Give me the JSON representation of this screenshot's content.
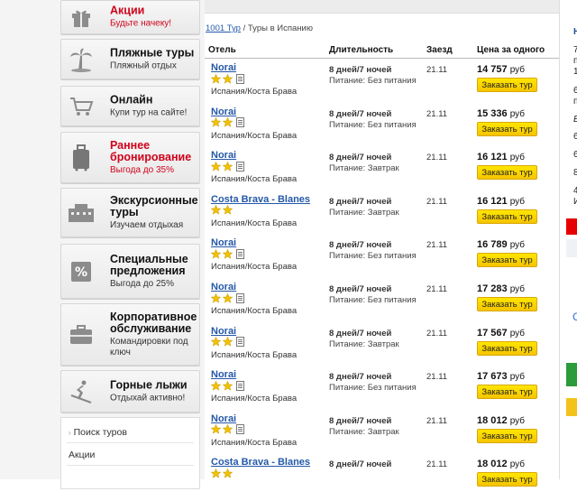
{
  "sidebar": {
    "items": [
      {
        "title": "Акции",
        "sub": "Будьте начеку!",
        "icon": "gift-icon",
        "red": true
      },
      {
        "title": "Пляжные туры",
        "sub": "Пляжный отдых",
        "icon": "palm-icon",
        "red": false
      },
      {
        "title": "Онлайн",
        "sub": "Купи тур на сайте!",
        "icon": "cart-icon",
        "red": false
      },
      {
        "title": "Раннее бронирование",
        "sub": "Выгода до 35%",
        "icon": "suitcase-icon",
        "red": true
      },
      {
        "title": "Экскурсионные туры",
        "sub": "Изучаем отдыхая",
        "icon": "building-icon",
        "red": false
      },
      {
        "title": "Специальные предложения",
        "sub": "Выгода до 25%",
        "icon": "percent-icon",
        "red": false
      },
      {
        "title": "Корпоративное обслуживание",
        "sub": "Командировки под ключ",
        "icon": "briefcase-icon",
        "red": false
      },
      {
        "title": "Горные лыжи",
        "sub": "Отдыхай активно!",
        "icon": "skier-icon",
        "red": false
      }
    ],
    "links": [
      "Поиск туров",
      "Акции"
    ]
  },
  "breadcrumb": {
    "root": "1001 Тур",
    "current": "Туры в Испанию"
  },
  "table": {
    "headers": [
      "Отель",
      "Длительность",
      "Заезд",
      "Цена за одного"
    ],
    "currency": "руб",
    "button_label": "Заказать тур",
    "rows": [
      {
        "hotel": "Norai",
        "stars": 2,
        "location": "Испания/Коста Брава",
        "duration": "8 дней/7 ночей",
        "meal": "Питание: Без питания",
        "date": "21.11",
        "price": "14 757"
      },
      {
        "hotel": "Norai",
        "stars": 2,
        "location": "Испания/Коста Брава",
        "duration": "8 дней/7 ночей",
        "meal": "Питание: Без питания",
        "date": "21.11",
        "price": "15 336"
      },
      {
        "hotel": "Norai",
        "stars": 2,
        "location": "Испания/Коста Брава",
        "duration": "8 дней/7 ночей",
        "meal": "Питание: Завтрак",
        "date": "21.11",
        "price": "16 121"
      },
      {
        "hotel": "Costa Brava - Blanes",
        "stars": 2,
        "location": "Испания/Коста Брава",
        "duration": "8 дней/7 ночей",
        "meal": "Питание: Завтрак",
        "date": "21.11",
        "price": "16 121"
      },
      {
        "hotel": "Norai",
        "stars": 2,
        "location": "Испания/Коста Брава",
        "duration": "8 дней/7 ночей",
        "meal": "Питание: Без питания",
        "date": "21.11",
        "price": "16 789"
      },
      {
        "hotel": "Norai",
        "stars": 2,
        "location": "Испания/Коста Брава",
        "duration": "8 дней/7 ночей",
        "meal": "Питание: Без питания",
        "date": "21.11",
        "price": "17 283"
      },
      {
        "hotel": "Norai",
        "stars": 2,
        "location": "Испания/Коста Брава",
        "duration": "8 дней/7 ночей",
        "meal": "Питание: Завтрак",
        "date": "21.11",
        "price": "17 567"
      },
      {
        "hotel": "Norai",
        "stars": 2,
        "location": "Испания/Коста Брава",
        "duration": "8 дней/7 ночей",
        "meal": "Питание: Без питания",
        "date": "21.11",
        "price": "17 673"
      },
      {
        "hotel": "Norai",
        "stars": 2,
        "location": "Испания/Коста Брава",
        "duration": "8 дней/7 ночей",
        "meal": "Питание: Завтрак",
        "date": "21.11",
        "price": "18 012"
      },
      {
        "hotel": "Costa Brava - Blanes",
        "stars": 2,
        "location": "",
        "duration": "8 дней/7 ночей",
        "meal": "",
        "date": "21.11",
        "price": "18 012"
      }
    ]
  },
  "right_strip": {
    "heading": "Н",
    "lines": [
      "7",
      "п",
      "1",
      "6",
      "п",
      "Е",
      "6",
      "6",
      "8",
      "4",
      "И"
    ]
  },
  "colors": {
    "accent_red": "#d0021b",
    "link_blue": "#2458a8",
    "button_yellow": "#ffd400"
  }
}
